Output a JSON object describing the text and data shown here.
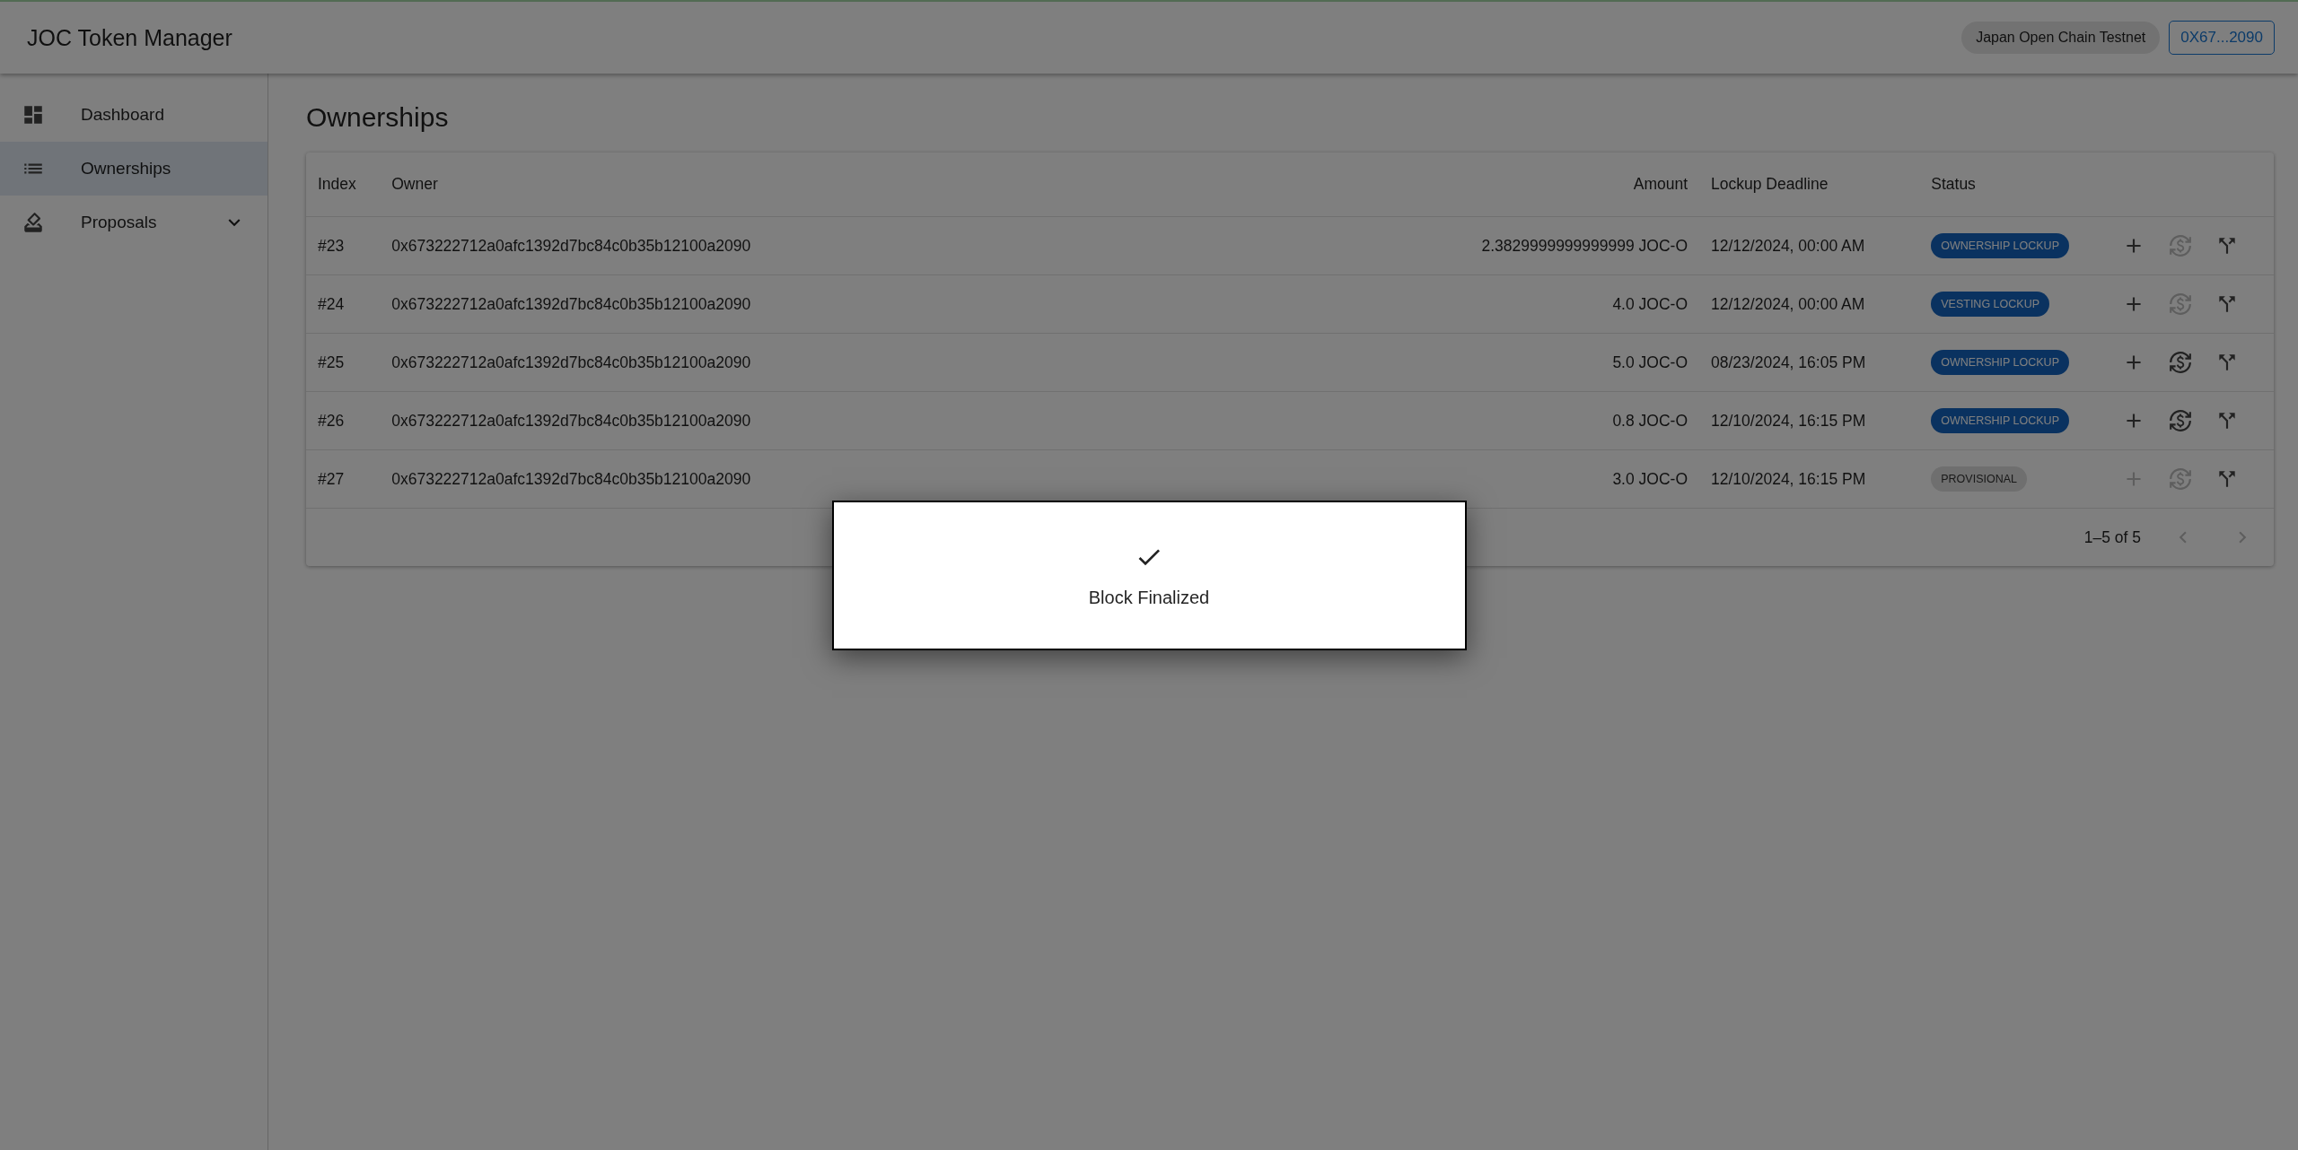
{
  "app_bar": {
    "title": "JOC Token Manager",
    "network": "Japan Open Chain Testnet",
    "account": "0X67...2090"
  },
  "sidebar": {
    "items": [
      {
        "label": "Dashboard",
        "selected": false
      },
      {
        "label": "Ownerships",
        "selected": true
      },
      {
        "label": "Proposals",
        "selected": false,
        "expanded": false
      }
    ]
  },
  "page_title": "Ownerships",
  "table": {
    "columns": [
      "Index",
      "Owner",
      "Amount",
      "Lockup Deadline",
      "Status"
    ],
    "rows": [
      {
        "index": "#23",
        "owner": "0x673222712a0afc1392d7bc84c0b35b12100a2090",
        "amount": "2.3829999999999999 JOC-O",
        "deadline": "12/12/2024, 00:00 AM",
        "status": {
          "label": "OWNERSHIP LOCKUP",
          "kind": "lockup"
        },
        "add_enabled": true,
        "exchange_enabled": false
      },
      {
        "index": "#24",
        "owner": "0x673222712a0afc1392d7bc84c0b35b12100a2090",
        "amount": "4.0 JOC-O",
        "deadline": "12/12/2024, 00:00 AM",
        "status": {
          "label": "VESTING LOCKUP",
          "kind": "lockup"
        },
        "add_enabled": true,
        "exchange_enabled": false
      },
      {
        "index": "#25",
        "owner": "0x673222712a0afc1392d7bc84c0b35b12100a2090",
        "amount": "5.0 JOC-O",
        "deadline": "08/23/2024, 16:05 PM",
        "status": {
          "label": "OWNERSHIP LOCKUP",
          "kind": "lockup"
        },
        "add_enabled": true,
        "exchange_enabled": true
      },
      {
        "index": "#26",
        "owner": "0x673222712a0afc1392d7bc84c0b35b12100a2090",
        "amount": "0.8 JOC-O",
        "deadline": "12/10/2024, 16:15 PM",
        "status": {
          "label": "OWNERSHIP LOCKUP",
          "kind": "lockup"
        },
        "add_enabled": true,
        "exchange_enabled": true
      },
      {
        "index": "#27",
        "owner": "0x673222712a0afc1392d7bc84c0b35b12100a2090",
        "amount": "3.0 JOC-O",
        "deadline": "12/10/2024, 16:15 PM",
        "status": {
          "label": "PROVISIONAL",
          "kind": "provisional"
        },
        "add_enabled": false,
        "exchange_enabled": false
      }
    ],
    "pagination": {
      "range": "1–5 of 5",
      "prev_enabled": false,
      "next_enabled": false
    }
  },
  "dialog": {
    "message": "Block Finalized"
  }
}
